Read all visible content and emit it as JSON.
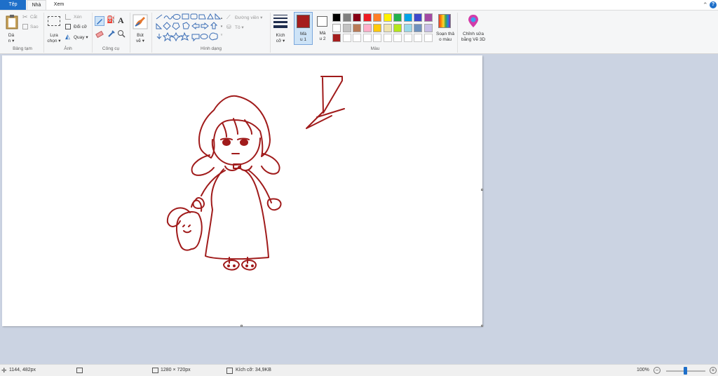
{
  "tabs": {
    "file": "Tệp",
    "home": "Nhà",
    "view": "Xem"
  },
  "clipboard": {
    "paste": "Dá",
    "paste_caret": "n ▾",
    "cut": "Cắt",
    "copy": "Sao",
    "group": "Bảng tạm"
  },
  "image": {
    "select": "Lựa",
    "select2": "chọn ▾",
    "crop": "Xén",
    "resize": "Đổi cỡ",
    "rotate": "Quay ▾",
    "group": "Ảnh"
  },
  "tools": {
    "group": "Công cụ",
    "text_icon": "A"
  },
  "brushes": {
    "label": "Bút",
    "label2": "vẽ ▾"
  },
  "shapes": {
    "outline": "Đường viền ▾",
    "fill": "Tô ▾",
    "group": "Hình dạng"
  },
  "size": {
    "label": "Kích",
    "label2": "cỡ ▾"
  },
  "color1": {
    "label": "Mà",
    "label2": "u 1",
    "value": "#a51d1d"
  },
  "color2": {
    "label": "Mà",
    "label2": "u 2",
    "value": "#ffffff"
  },
  "colors": {
    "group": "Màu",
    "row1": [
      "#000000",
      "#7f7f7f",
      "#880015",
      "#ed1c24",
      "#ff7f27",
      "#fff200",
      "#22b14c",
      "#00a2e8",
      "#3f48cc",
      "#a349a4"
    ],
    "row2": [
      "#ffffff",
      "#c3c3c3",
      "#b97a57",
      "#ffaec9",
      "#ffc90e",
      "#efe4b0",
      "#b5e61d",
      "#99d9ea",
      "#7092be",
      "#c8bfe7"
    ],
    "row3_first": "#a51d1d",
    "edit_colors": "Soạn thả",
    "edit_colors2": "o màu",
    "paint3d": "Chỉnh sửa",
    "paint3d2": "bằng Vẽ 3D"
  },
  "drawing": {
    "stroke": "#a01b1b"
  },
  "status": {
    "cursor": "1144, 482px",
    "dimensions": "1280 × 720px",
    "file_size": "Kích cỡ: 34,9KB",
    "zoom": "100%",
    "zoom_level": 0.5
  }
}
